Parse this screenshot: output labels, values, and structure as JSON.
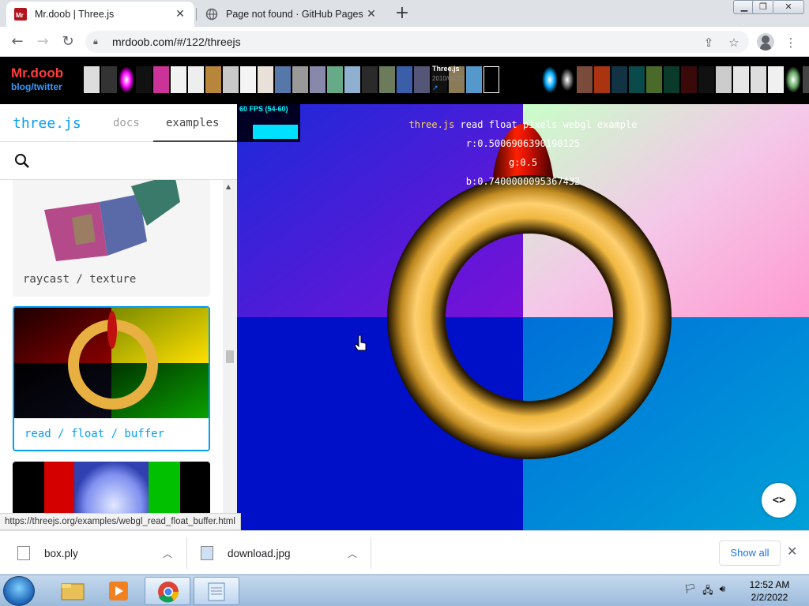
{
  "browser": {
    "tabs": [
      {
        "title": "Mr.doob | Three.js",
        "active": true,
        "favicon": "mrdoob-icon"
      },
      {
        "title": "Page not found · GitHub Pages",
        "active": false,
        "favicon": "globe-icon"
      }
    ],
    "address": "mrdoob.com/#/122/threejs"
  },
  "banner": {
    "logo": "Mr.doob",
    "sublinks": "blog/twitter",
    "info_title": "Three.js",
    "info_date": "2010/04/23",
    "info_link": "↗"
  },
  "sidebar": {
    "brand": "three.js",
    "nav": {
      "docs": "docs",
      "examples": "examples"
    },
    "cards": [
      {
        "label": "raycast / texture"
      },
      {
        "label": "read / float / buffer"
      },
      {
        "label": ""
      }
    ]
  },
  "viewport": {
    "fps": "60 FPS (54-60)",
    "title_link": "three.js",
    "title_rest": " read float pixels webgl example",
    "r": "r:0.5006906390190125",
    "g": "g:0.5",
    "b": "b:0.7400000095367432",
    "code_button": "<>"
  },
  "status_url": "https://threejs.org/examples/webgl_read_float_buffer.html",
  "downloads": {
    "items": [
      {
        "name": "box.ply"
      },
      {
        "name": "download.jpg"
      }
    ],
    "show_all": "Show all"
  },
  "taskbar": {
    "time": "12:52 AM",
    "date": "2/2/2022"
  },
  "colors": {
    "accent": "#049ef4",
    "chrome_blue": "#1a73e8"
  }
}
